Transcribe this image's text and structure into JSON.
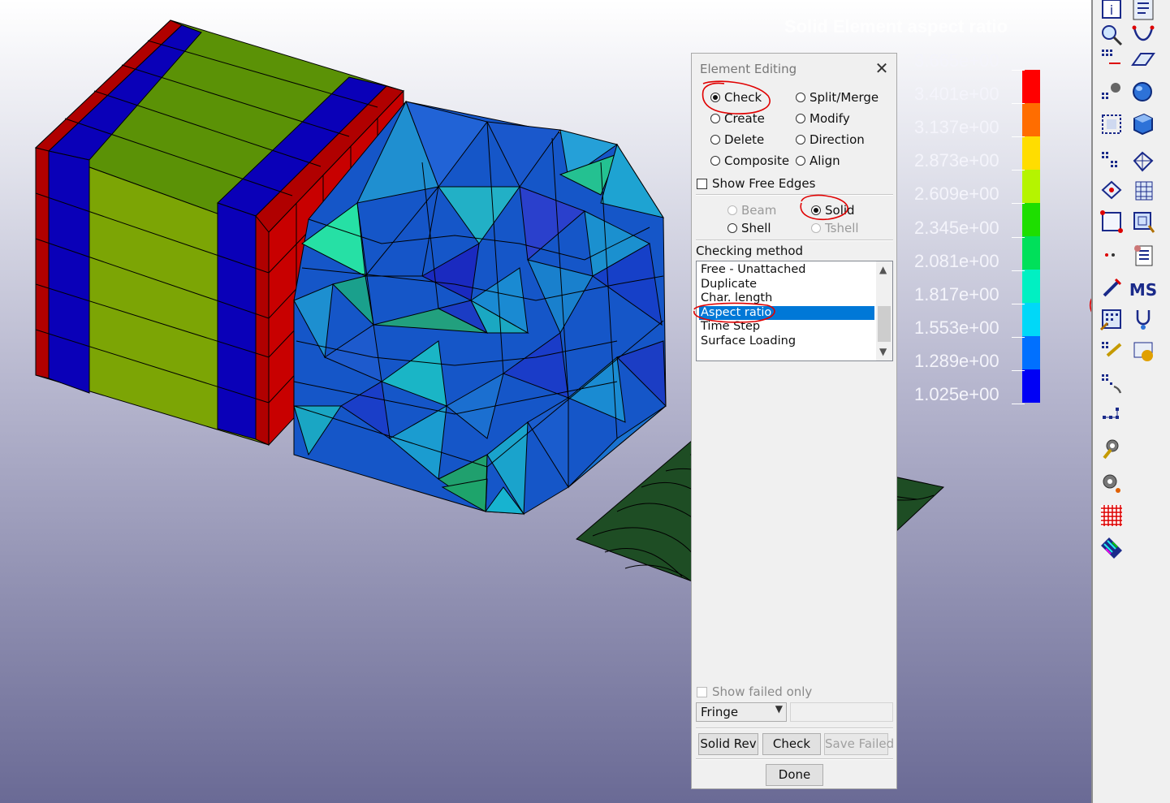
{
  "legend": {
    "title": "Solid Element aspect ratio",
    "labels": [
      "3.665e+00",
      "3.401e+00",
      "3.137e+00",
      "2.873e+00",
      "2.609e+00",
      "2.345e+00",
      "2.081e+00",
      "1.817e+00",
      "1.553e+00",
      "1.289e+00",
      "1.025e+00"
    ],
    "colors": [
      "#ff0000",
      "#ff6d00",
      "#ffdd00",
      "#b5f400",
      "#1ede00",
      "#00e05a",
      "#00f0c2",
      "#00d8f8",
      "#0070ff",
      "#0000f5"
    ]
  },
  "dialog": {
    "title": "Element Editing",
    "close": "✕",
    "actions": {
      "check": "Check",
      "create": "Create",
      "delete": "Delete",
      "composite": "Composite",
      "split_merge": "Split/Merge",
      "modify": "Modify",
      "direction": "Direction",
      "align": "Align",
      "selected": "Check"
    },
    "show_free_edges": "Show Free Edges",
    "element_types": {
      "beam": "Beam",
      "solid": "Solid",
      "shell": "Shell",
      "tshell": "Tshell",
      "selected": "Solid"
    },
    "checking_method_label": "Checking method",
    "methods": [
      "Free - Unattached",
      "Duplicate",
      "Char. length",
      "Aspect ratio",
      "Time Step",
      "Surface Loading"
    ],
    "selected_method": "Aspect ratio",
    "show_failed_only": "Show failed only",
    "display_mode": "Fringe",
    "buttons": {
      "solid_rev": "Solid Rev",
      "check": "Check",
      "save_failed": "Save Failed",
      "done": "Done"
    }
  },
  "toolbar": {
    "icons": [
      "element-info-icon",
      "model-tree-icon",
      "zoom-find-icon",
      "curve-icon",
      "node-transform-icon",
      "plane-icon",
      "node-gear-icon",
      "sphere-part-icon",
      "node-box-icon",
      "solid-box-icon",
      "node-grid-icon",
      "mesh-net-icon",
      "point-move-icon",
      "table-mesh-icon",
      "node-frame-icon",
      "element-edit-icon",
      "node-dots-icon",
      "report-icon",
      "pencil-icon",
      "ms-text-icon",
      "element-check-icon",
      "stethoscope-icon",
      "node-ruler-icon",
      "user-badge-icon",
      "node-hand-icon",
      "node-cluster-icon",
      "gear-wrench-icon",
      "gear-icon",
      "red-grid-icon",
      "multicolor-mesh-icon"
    ]
  }
}
